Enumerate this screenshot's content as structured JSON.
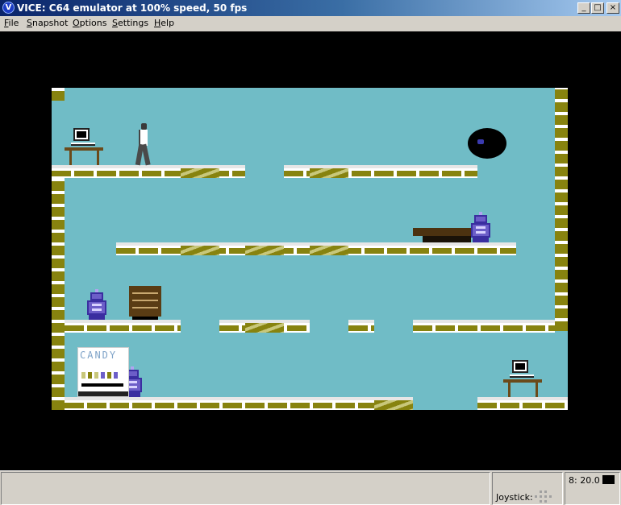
{
  "window": {
    "title": "VICE: C64 emulator at 100% speed, 50 fps",
    "icon": "vice-app-icon",
    "controls": {
      "minimize": "_",
      "maximize": "□",
      "close": "×"
    }
  },
  "menu": {
    "items": [
      {
        "label": "File",
        "underline": "F",
        "rest": "ile"
      },
      {
        "label": "Snapshot",
        "underline": "S",
        "rest": "napshot"
      },
      {
        "label": "Options",
        "underline": "O",
        "rest": "ptions"
      },
      {
        "label": "Settings",
        "underline": "S",
        "rest": "ettings"
      },
      {
        "label": "Help",
        "underline": "H",
        "rest": "elp"
      }
    ]
  },
  "game": {
    "vending_machine_label": "CANDY",
    "colors": {
      "background": "#70bcc6",
      "border": "#000000",
      "platform": "#87830f",
      "robot": "#6c5ec8"
    }
  },
  "status": {
    "joystick_label": "Joystick:",
    "drive_label": "8: 20.0"
  }
}
